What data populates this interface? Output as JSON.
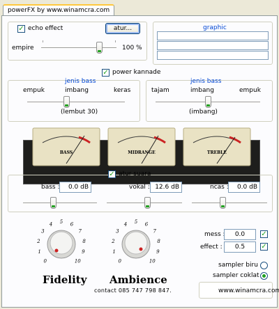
{
  "window": {
    "tab_label": "powerFX by www.winamcra.com"
  },
  "echo": {
    "checkbox_label": "echo effect",
    "checked": true,
    "settings_button": "atur...",
    "slider_left_label": "empire",
    "slider_right_label": "100 %",
    "slider_value": 0.8
  },
  "graphic": {
    "title": "graphic"
  },
  "power": {
    "label": "power kannade",
    "checked": true
  },
  "left_eq": {
    "title": "jenis bass",
    "left_label": "empuk",
    "mid_label": "imbang",
    "right_label": "keras",
    "status": "(lembut 30)",
    "slider_value": 0.4
  },
  "right_eq": {
    "title": "jenis bass",
    "left_label": "tajam",
    "mid_label": "imbang",
    "right_label": "empuk",
    "status": "(imbang)",
    "slider_value": 0.5
  },
  "meters": [
    {
      "label": "BASS"
    },
    {
      "label": "MIDRANGE"
    },
    {
      "label": "TREBLE"
    }
  ],
  "sound": {
    "checkbox_label": "atur suara",
    "checked": true,
    "bass_label": "bass :",
    "bass_value": "0.0 dB",
    "vocal_label": "vokal :",
    "vocal_value": "12.6 dB",
    "noise_label": "ncas :",
    "noise_value": "0.0 dB",
    "bass_slider": 0.4,
    "vocal_slider": 0.55,
    "noise_slider": 0.4
  },
  "knobs": [
    {
      "label": "Fidelity",
      "scale": [
        "0",
        "1",
        "2",
        "3",
        "4",
        "5",
        "6",
        "7",
        "8",
        "9",
        "10"
      ]
    },
    {
      "label": "Ambience",
      "scale": [
        "0",
        "1",
        "2",
        "3",
        "4",
        "5",
        "6",
        "7",
        "8",
        "9",
        "10"
      ]
    }
  ],
  "right_controls": {
    "mess_label": "mess :",
    "mess_value": "0.0",
    "mess_checked": true,
    "effect_label": "effect :",
    "effect_value": "0.5",
    "effect_checked": true,
    "radio1_label": "sampler biru",
    "radio1_on": false,
    "radio2_label": "sampler coklat",
    "radio2_on": true
  },
  "footer": {
    "contact": "contact 085 747 798 847.",
    "website": "www.winamcra.com"
  },
  "colors": {
    "accent": "#21a121",
    "link": "#0046d5",
    "needle": "#cc2222"
  }
}
